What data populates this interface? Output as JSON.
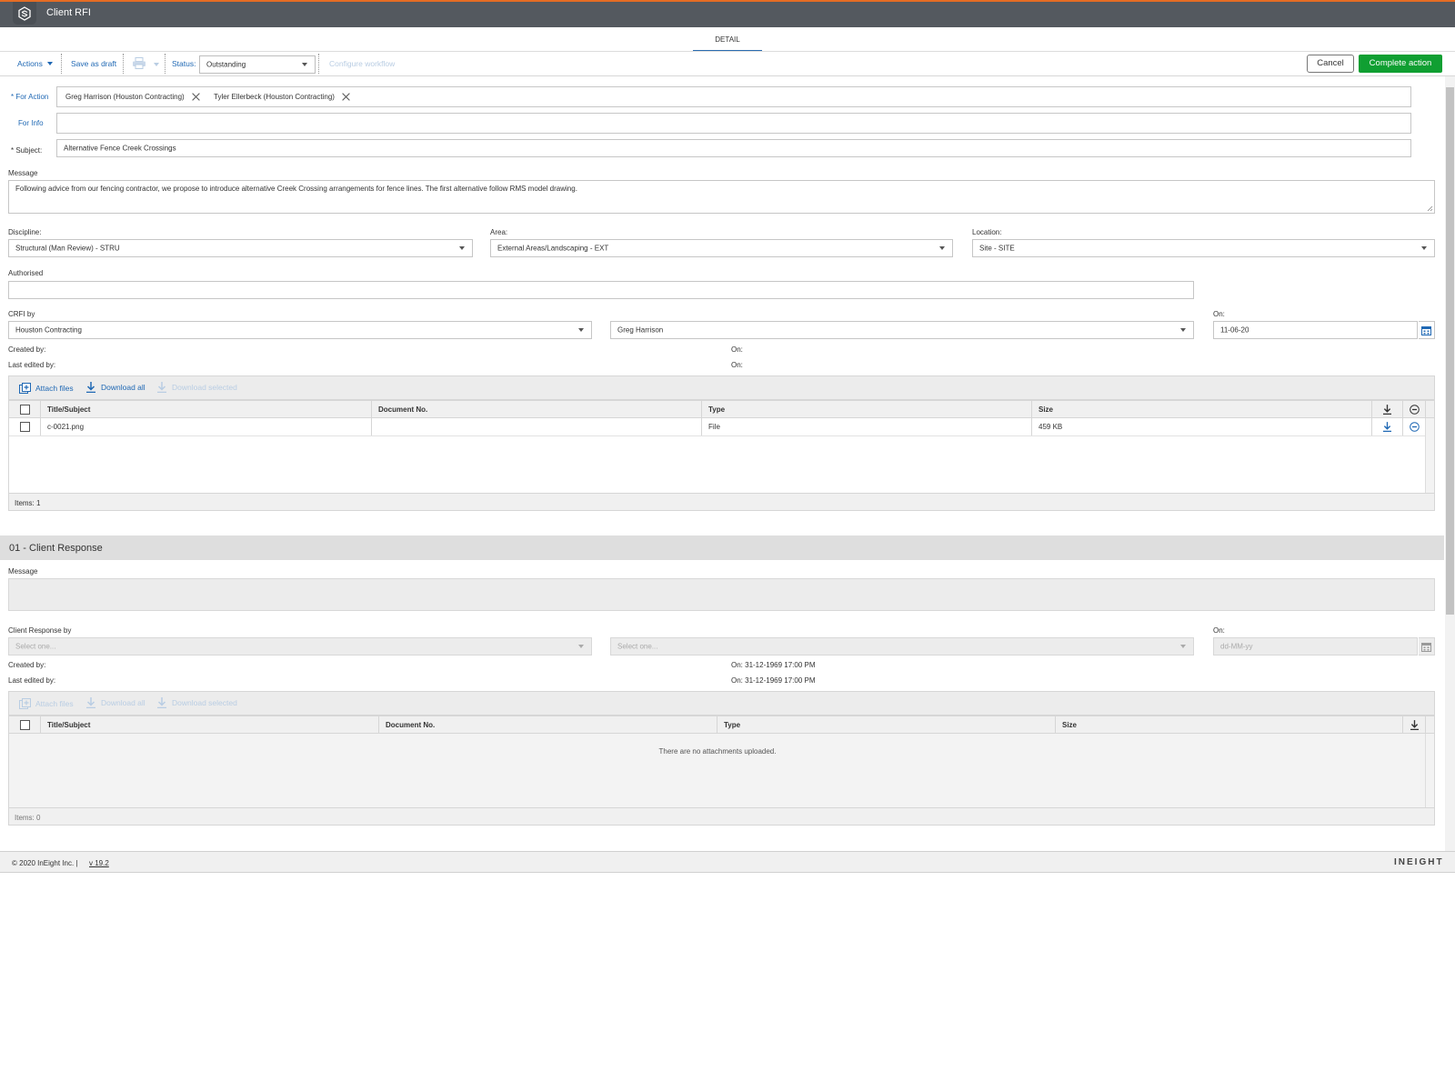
{
  "app": {
    "title": "Client RFI"
  },
  "tabs": [
    {
      "label": "DETAIL"
    }
  ],
  "toolbar": {
    "actions_label": "Actions",
    "save_draft_label": "Save as draft",
    "status_label": "Status:",
    "status_value": "Outstanding",
    "configure_workflow_label": "Configure workflow",
    "cancel_label": "Cancel",
    "complete_label": "Complete action",
    "complete_color": "#109f32"
  },
  "form": {
    "for_action_label": "* For Action",
    "for_action_recipients": [
      "Greg Harrison (Houston Contracting)",
      "Tyler Ellerbeck (Houston Contracting)"
    ],
    "for_info_label": "For Info",
    "subject_label": "* Subject:",
    "subject_value": "Alternative Fence Creek Crossings",
    "message_label": "Message",
    "message_value": "Following advice from our fencing contractor, we propose to introduce alternative Creek Crossing arrangements for fence lines.  The first alternative follow RMS model drawing.",
    "discipline_label": "Discipline:",
    "discipline_value": "Structural (Man Review) - STRU",
    "area_label": "Area:",
    "area_value": "External Areas/Landscaping - EXT",
    "location_label": "Location:",
    "location_value": "Site - SITE",
    "authorised_label": "Authorised",
    "crfi_by_label": "CRFI by",
    "crfi_company": "Houston Contracting",
    "crfi_person": "Greg Harrison",
    "on_label": "On:",
    "crfi_date": "11-06-20",
    "created_by_label": "Created by:",
    "last_edited_by_label": "Last edited by:",
    "created_on": "On:",
    "edited_on": "On:"
  },
  "attachments": {
    "attach_label": "Attach files",
    "download_all_label": "Download all",
    "download_selected_label": "Download selected",
    "columns": [
      "Title/Subject",
      "Document No.",
      "Type",
      "Size"
    ],
    "rows": [
      {
        "title": "c-0021.png",
        "doc_no": "",
        "type": "File",
        "size": "459 KB"
      }
    ],
    "items_label": "Items: 1"
  },
  "response": {
    "section_title": "01 - Client Response",
    "message_label": "Message",
    "response_by_label": "Client Response by",
    "company_placeholder": "Select one...",
    "person_placeholder": "Select one...",
    "on_label": "On:",
    "date_placeholder": "dd-MM-yy",
    "created_by_label": "Created by:",
    "last_edited_by_label": "Last edited by:",
    "created_on": "On: 31-12-1969 17:00 PM",
    "edited_on": "On: 31-12-1969 17:00 PM",
    "attachments": {
      "attach_label": "Attach files",
      "download_all_label": "Download all",
      "download_selected_label": "Download selected",
      "columns": [
        "Title/Subject",
        "Document No.",
        "Type",
        "Size"
      ],
      "empty_label": "There are no attachments uploaded.",
      "items_label": "Items: 0"
    }
  },
  "footer": {
    "copyright": "© 2020 InEight Inc.   |",
    "version": "v 19.2",
    "brand": "INEIGHT"
  }
}
